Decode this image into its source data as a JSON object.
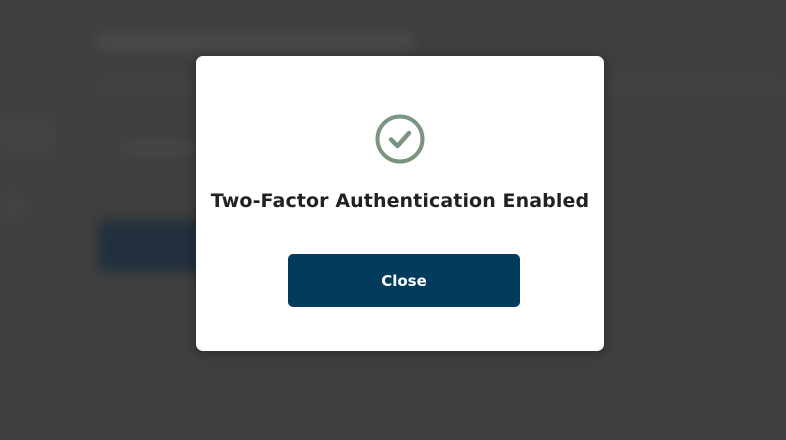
{
  "modal": {
    "title": "Two-Factor Authentication Enabled",
    "icon": "check-circle-icon",
    "close_label": "Close"
  },
  "colors": {
    "overlay": "#3f3f3f",
    "modal_bg": "#ffffff",
    "icon_color": "#7a9480",
    "title_color": "#222222",
    "button_bg": "#033b5c",
    "button_text": "#ffffff"
  }
}
